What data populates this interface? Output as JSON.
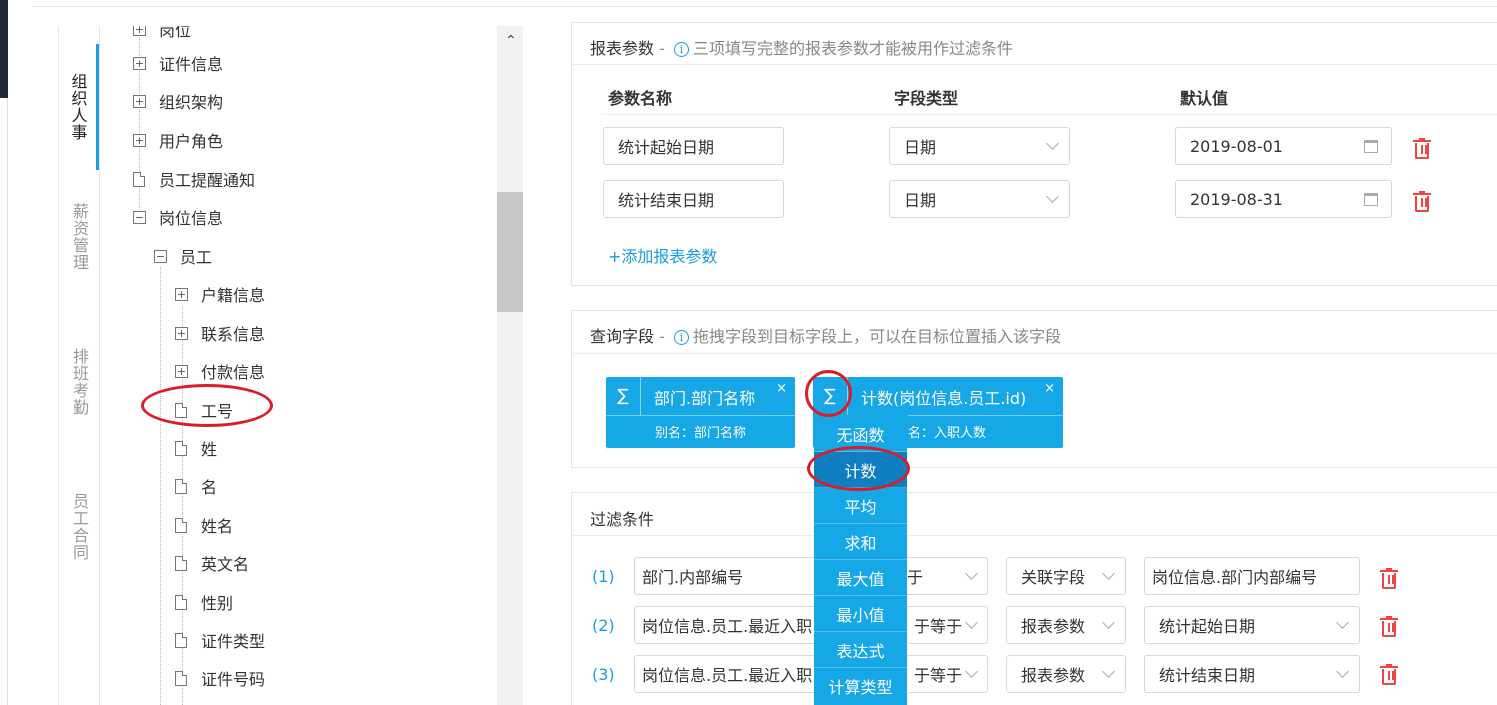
{
  "side_tabs": [
    {
      "label": "组织人事",
      "active": true
    },
    {
      "label": "薪资管理",
      "active": false
    },
    {
      "label": "排班考勤",
      "active": false
    },
    {
      "label": "员工合同",
      "active": false
    }
  ],
  "tree": {
    "nodes": [
      {
        "label": "岗位",
        "kind": "plus"
      },
      {
        "label": "证件信息",
        "kind": "plus"
      },
      {
        "label": "组织架构",
        "kind": "plus"
      },
      {
        "label": "用户角色",
        "kind": "plus"
      },
      {
        "label": "员工提醒通知",
        "kind": "file"
      },
      {
        "label": "岗位信息",
        "kind": "minus"
      },
      {
        "label": "员工",
        "kind": "minus"
      },
      {
        "label": "户籍信息",
        "kind": "plus"
      },
      {
        "label": "联系信息",
        "kind": "plus"
      },
      {
        "label": "付款信息",
        "kind": "plus"
      },
      {
        "label": "工号",
        "kind": "file"
      },
      {
        "label": "姓",
        "kind": "file"
      },
      {
        "label": "名",
        "kind": "file"
      },
      {
        "label": "姓名",
        "kind": "file"
      },
      {
        "label": "英文名",
        "kind": "file"
      },
      {
        "label": "性别",
        "kind": "file"
      },
      {
        "label": "证件类型",
        "kind": "file"
      },
      {
        "label": "证件号码",
        "kind": "file"
      }
    ]
  },
  "report_params": {
    "title": "报表参数",
    "dash": "-",
    "info_icon": "info-icon",
    "hint": "三项填写完整的报表参数才能被用作过滤条件",
    "col_name": "参数名称",
    "col_type": "字段类型",
    "col_default": "默认值",
    "rows": [
      {
        "name": "统计起始日期",
        "type": "日期",
        "default": "2019-08-01"
      },
      {
        "name": "统计结束日期",
        "type": "日期",
        "default": "2019-08-31"
      }
    ],
    "add_label": "+添加报表参数"
  },
  "query_fields": {
    "title": "查询字段",
    "dash": "-",
    "hint": "拖拽字段到目标字段上，可以在目标位置插入该字段",
    "sigma": "∑",
    "close": "×",
    "chips": [
      {
        "name": "部门.部门名称",
        "alias": "别名：部门名称"
      },
      {
        "name": "计数(岗位信息.员工.id)",
        "alias": "名：入职人数"
      }
    ]
  },
  "agg_menu": {
    "items": [
      "无函数",
      "计数",
      "平均",
      "求和",
      "最大值",
      "最小值",
      "表达式",
      "计算类型"
    ],
    "selected": "计数"
  },
  "filters": {
    "title": "过滤条件",
    "rows": [
      {
        "num": "(1)",
        "field": "部门.内部编号",
        "op": "于",
        "src": "关联字段",
        "value": "岗位信息.部门内部编号"
      },
      {
        "num": "(2)",
        "field": "岗位信息.员工.最近入职",
        "op": "于等于",
        "src": "报表参数",
        "value": "统计起始日期"
      },
      {
        "num": "(3)",
        "field": "岗位信息.员工.最近入职",
        "op": "于等于",
        "src": "报表参数",
        "value": "统计结束日期"
      }
    ]
  },
  "scroll_up": "⌃",
  "colors": {
    "accent": "#1a9be6",
    "chip": "#15a7e6",
    "danger": "#e44444",
    "highlight_ring": "#d81e2a"
  }
}
